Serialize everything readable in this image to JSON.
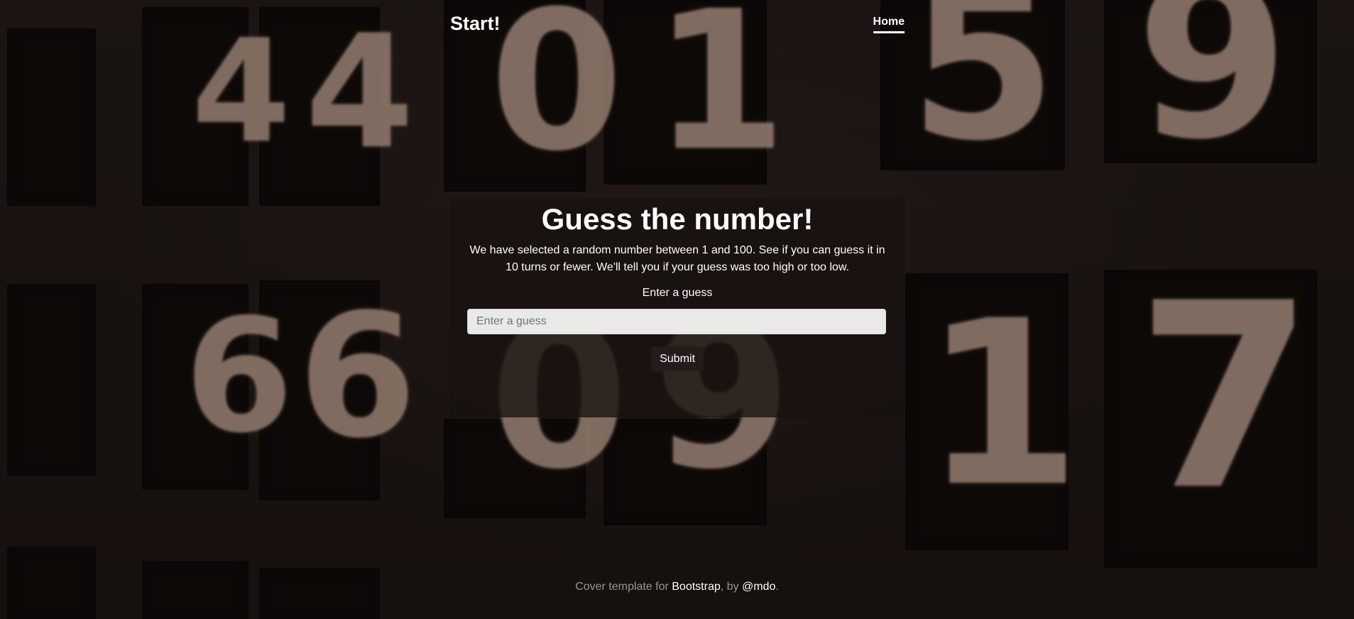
{
  "header": {
    "brand": "Start!",
    "nav": [
      {
        "label": "Home",
        "active": true
      }
    ]
  },
  "main": {
    "title": "Guess the number!",
    "description": "We have selected a random number between 1 and 100. See if you can guess it in 10 turns or fewer. We'll tell you if your guess was too high or too low.",
    "guess_label": "Enter a guess",
    "guess_input": {
      "value": "",
      "placeholder": "Enter a guess"
    },
    "submit_label": "Submit"
  },
  "footer": {
    "prefix": "Cover template for ",
    "link1": "Bootstrap",
    "middle": ", by ",
    "link2": "@mdo",
    "suffix": "."
  },
  "background": {
    "digits": [
      "4",
      "4",
      "0",
      "1",
      "5",
      "9",
      "6",
      "6",
      "0",
      "9",
      "1",
      "7"
    ]
  },
  "colors": {
    "background": "#1a1412",
    "card": "#181210",
    "text": "#ffffff",
    "input": "#e9e9ea"
  }
}
